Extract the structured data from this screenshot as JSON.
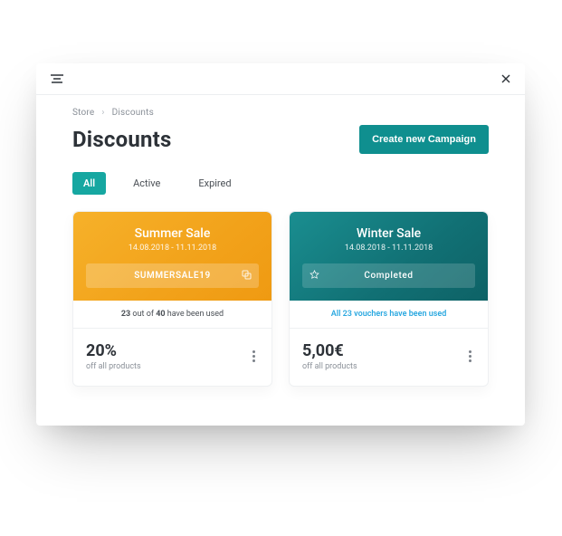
{
  "breadcrumb": {
    "root": "Store",
    "current": "Discounts"
  },
  "page": {
    "title": "Discounts"
  },
  "actions": {
    "create": "Create new Campaign"
  },
  "tabs": {
    "all": "All",
    "active": "Active",
    "expired": "Expired"
  },
  "cards": [
    {
      "title": "Summer  Sale",
      "dates": "14.08.2018 - 11.11.2018",
      "code": "SUMMERSALE19",
      "usage_prefix": "23",
      "usage_mid": " out of ",
      "usage_count": "40",
      "usage_suffix": " have been used",
      "value": "20%",
      "value_sub": "off all products"
    },
    {
      "title": "Winter Sale",
      "dates": "14.08.2018 - 11.11.2018",
      "status": "Completed",
      "usage_link": "All 23 vouchers have been used",
      "value": "5,00€",
      "value_sub": "off all products"
    }
  ]
}
